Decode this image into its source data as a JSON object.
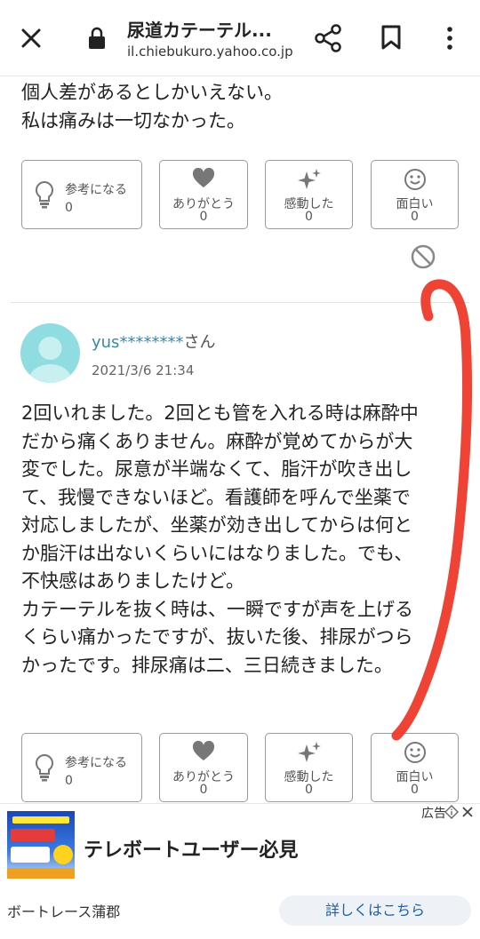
{
  "browser": {
    "page_title": "尿道カテーテル...",
    "url": "il.chiebukuro.yahoo.co.jp",
    "close_icon": "close-icon",
    "lock_icon": "lock-icon",
    "share_icon": "share-icon",
    "bookmark_icon": "bookmark-icon",
    "more_icon": "more-vertical-icon"
  },
  "answer1": {
    "text_lines": [
      "個人差があるとしかいえない。",
      "私は痛みは一切なかった。"
    ],
    "reactions": {
      "sanko": {
        "label": "参考になる",
        "count": "0"
      },
      "arigato": {
        "label": "ありがとう",
        "count": "0"
      },
      "kando": {
        "label": "感動した",
        "count": "0"
      },
      "omoshiroi": {
        "label": "面白い",
        "count": "0"
      }
    }
  },
  "answer2": {
    "username": "yus********",
    "honorific": "さん",
    "date": "2021/3/6 21:34",
    "text_lines": [
      "2回いれました。2回とも管を入れる時は麻酔中",
      "だから痛くありません。麻酔が覚めてからが大",
      "変でした。尿意が半端なくて、脂汗が吹き出し",
      "て、我慢できないほど。看護師を呼んで坐薬で",
      "対応しましたが、坐薬が効き出してからは何と",
      "か脂汗は出ないくらいにはなりました。でも、",
      "不快感はありましたけど。",
      "カテーテルを抜く時は、一瞬ですが声を上げる",
      "くらい痛かったですが、抜いた後、排尿がつら",
      "かったです。排尿痛は二、三日続きました。"
    ],
    "reactions": {
      "sanko": {
        "label": "参考になる",
        "count": "0"
      },
      "arigato": {
        "label": "ありがとう",
        "count": "0"
      },
      "kando": {
        "label": "感動した",
        "count": "0"
      },
      "omoshiroi": {
        "label": "面白い",
        "count": "0"
      }
    }
  },
  "ad": {
    "label": "広告",
    "headline": "テレボートユーザー必見",
    "advertiser": "ボートレース蒲郡",
    "cta": "詳しくはこちら"
  },
  "colors": {
    "username": "#3a87a8",
    "avatar_bg": "#8fdde0",
    "annotation_red": "#ee3324",
    "cta_text": "#1d5fa8"
  }
}
